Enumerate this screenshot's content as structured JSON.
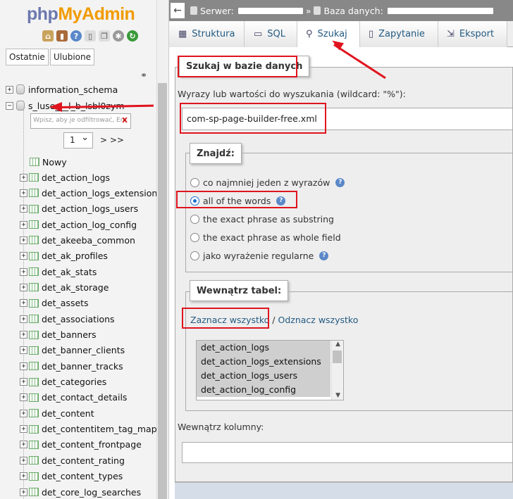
{
  "nav": {
    "logo_php": "php",
    "logo_myadmin": "MyAdmin",
    "icons": [
      "home-icon",
      "logout-icon",
      "help-icon",
      "docs-icon",
      "copy-icon",
      "settings-icon",
      "reload-icon"
    ],
    "recent_label": "Ostatnie",
    "favorites_label": "Ulubione",
    "db_information_schema": "information_schema",
    "db_current": "s_luse___l_b_lsbl0zym",
    "filter_placeholder": "Wpisz, aby je odfiltrować, En",
    "filter_clear": "X",
    "page_value": "1",
    "page_next": "> >>",
    "new_label": "Nowy",
    "tables": [
      "det_action_logs",
      "det_action_logs_extension",
      "det_action_logs_users",
      "det_action_log_config",
      "det_akeeba_common",
      "det_ak_profiles",
      "det_ak_stats",
      "det_ak_storage",
      "det_assets",
      "det_associations",
      "det_banners",
      "det_banner_clients",
      "det_banner_tracks",
      "det_categories",
      "det_contact_details",
      "det_content",
      "det_contentitem_tag_map",
      "det_content_frontpage",
      "det_content_rating",
      "det_content_types",
      "det_core_log_searches"
    ]
  },
  "topbar": {
    "back": "←",
    "server_label": "Serwer:",
    "db_label": "Baza danych:"
  },
  "tabs": [
    {
      "label": "Struktura",
      "icon": "structure-icon"
    },
    {
      "label": "SQL",
      "icon": "sql-icon"
    },
    {
      "label": "Szukaj",
      "icon": "search-icon",
      "active": true
    },
    {
      "label": "Zapytanie",
      "icon": "query-icon"
    },
    {
      "label": "Eksport",
      "icon": "export-icon"
    }
  ],
  "search": {
    "legend": "Szukaj w bazie danych",
    "criteria_label": "Wyrazy lub wartości do wyszukania (wildcard: \"%\"):",
    "criteria_value": "com-sp-page-builder-free.xml",
    "find_legend": "Znajdź:",
    "options": [
      {
        "label": "co najmniej jeden z wyrazów",
        "help": true,
        "checked": false
      },
      {
        "label": "all of the words",
        "help": true,
        "checked": true
      },
      {
        "label": "the exact phrase as substring",
        "help": false,
        "checked": false
      },
      {
        "label": "the exact phrase as whole field",
        "help": false,
        "checked": false
      },
      {
        "label": "jako wyrażenie regularne",
        "help": true,
        "checked": false
      }
    ],
    "tables_legend": "Wewnątrz tabel:",
    "select_all": "Zaznacz wszystko",
    "separator": " / ",
    "unselect_all": "Odznacz wszystko",
    "table_options": [
      "det_action_logs",
      "det_action_logs_extensions",
      "det_action_logs_users",
      "det_action_log_config"
    ],
    "column_label": "Wewnątrz kolumny:",
    "column_value": ""
  },
  "colors": {
    "annotation_red": "#e0141e",
    "link_blue": "#235a81",
    "logo_php": "#6c78af",
    "logo_myadmin": "#f29b00"
  }
}
